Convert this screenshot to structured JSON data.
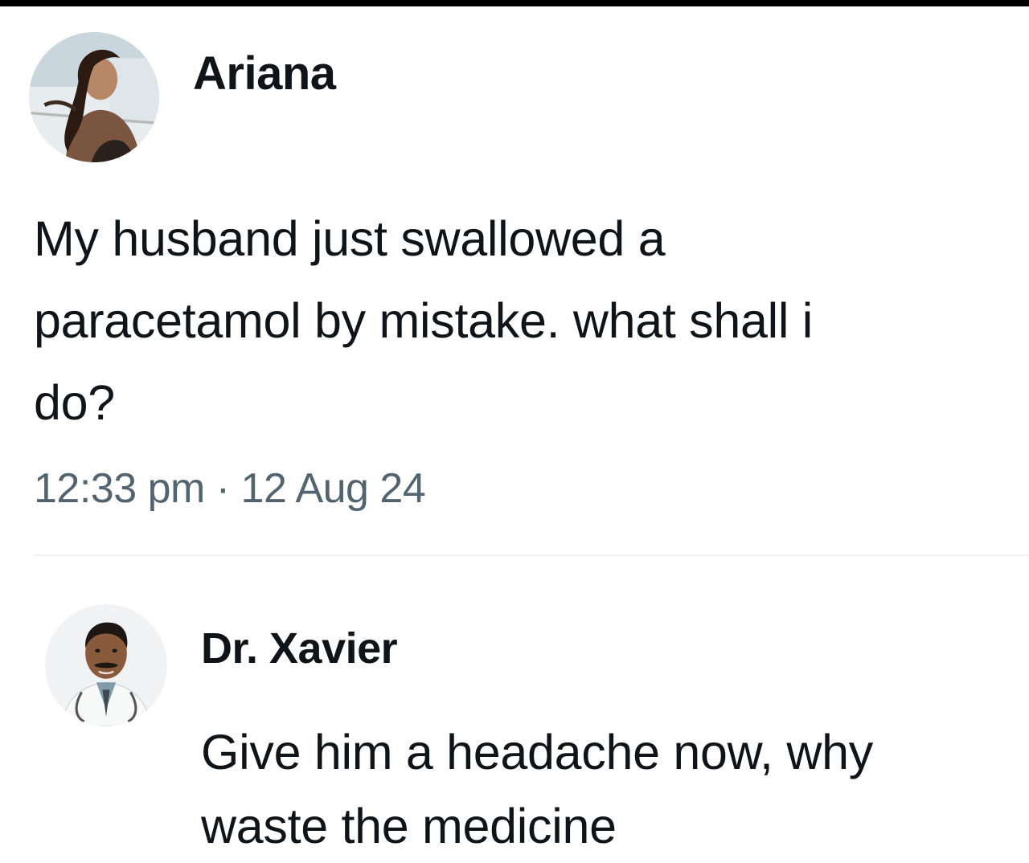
{
  "post": {
    "author_name": "Ariana",
    "avatar_icon": "user-avatar-photo",
    "text": "My husband just swallowed a\nparacetamol by mistake. what shall i\ndo?",
    "timestamp": "12:33 pm · 12 Aug 24"
  },
  "reply": {
    "author_name": "Dr. Xavier",
    "avatar_icon": "doctor-avatar-photo",
    "text": "Give him a headache now, why\nwaste the medicine"
  },
  "colors": {
    "text_primary": "#0f1419",
    "text_secondary": "#536471",
    "divider": "#eff3f4",
    "background": "#ffffff"
  }
}
